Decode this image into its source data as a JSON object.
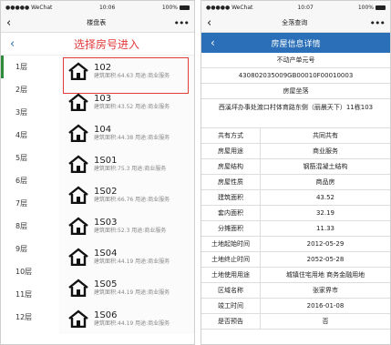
{
  "left": {
    "status": {
      "carrier": "●●●●● WeChat",
      "time": "10:06",
      "battery": "100%"
    },
    "nav": {
      "back": "‹",
      "title": "楼盘表",
      "more": "•••"
    },
    "header": {
      "back": "‹",
      "title": "选择房号进入"
    },
    "floors": [
      "1层",
      "2层",
      "3层",
      "4层",
      "5层",
      "6层",
      "7层",
      "8层",
      "9层",
      "10层",
      "11层",
      "12层"
    ],
    "active_floor": "1层",
    "rooms": [
      {
        "num": "102",
        "desc": "建筑面积:64.63 用途:商业服务"
      },
      {
        "num": "103",
        "desc": "建筑面积:43.52 用途:商业服务"
      },
      {
        "num": "104",
        "desc": "建筑面积:44.38 用途:商业服务"
      },
      {
        "num": "1S01",
        "desc": "建筑面积:75.3 用途:商业服务"
      },
      {
        "num": "1S02",
        "desc": "建筑面积:66.76 用途:商业服务"
      },
      {
        "num": "1S03",
        "desc": "建筑面积:52.3 用途:商业服务"
      },
      {
        "num": "1S04",
        "desc": "建筑面积:44.19 用途:商业服务"
      },
      {
        "num": "1S05",
        "desc": "建筑面积:44.19 用途:商业服务"
      },
      {
        "num": "1S06",
        "desc": "建筑面积:44.19 用途:商业服务"
      }
    ]
  },
  "right": {
    "status": {
      "carrier": "●●●●● WeChat",
      "time": "10:07",
      "battery": "100%"
    },
    "nav": {
      "back": "‹",
      "title": "全落查询",
      "more": "•••"
    },
    "header": {
      "back": "‹",
      "title": "房屋信息详情"
    },
    "unit_label": "不动产单元号",
    "unit_value": "430802035009GB00010F00010003",
    "location_label": "房屋坐落",
    "location_value": "西溪坪办事处渡口村体育路东侧（丽晨天下）11栋103",
    "fields": [
      {
        "k": "共有方式",
        "v": "共同共有"
      },
      {
        "k": "房屋用途",
        "v": "商业服务"
      },
      {
        "k": "房屋结构",
        "v": "钢筋混凝土结构"
      },
      {
        "k": "房屋性质",
        "v": "商品房"
      },
      {
        "k": "建筑面积",
        "v": "43.52"
      },
      {
        "k": "套内面积",
        "v": "32.19"
      },
      {
        "k": "分摊面积",
        "v": "11.33"
      },
      {
        "k": "土地起始时间",
        "v": "2012-05-29"
      },
      {
        "k": "土地终止时间",
        "v": "2052-05-28"
      },
      {
        "k": "土地使用用途",
        "v": "城镇住宅用地 商务金融用地"
      },
      {
        "k": "区域名称",
        "v": "张家界市"
      },
      {
        "k": "竣工时间",
        "v": "2016-01-08"
      },
      {
        "k": "是否预告",
        "v": "否"
      }
    ]
  },
  "colors": {
    "accent_red": "#e23b3b",
    "header_blue": "#2a6fb8",
    "active_green": "#2e8b3a"
  }
}
